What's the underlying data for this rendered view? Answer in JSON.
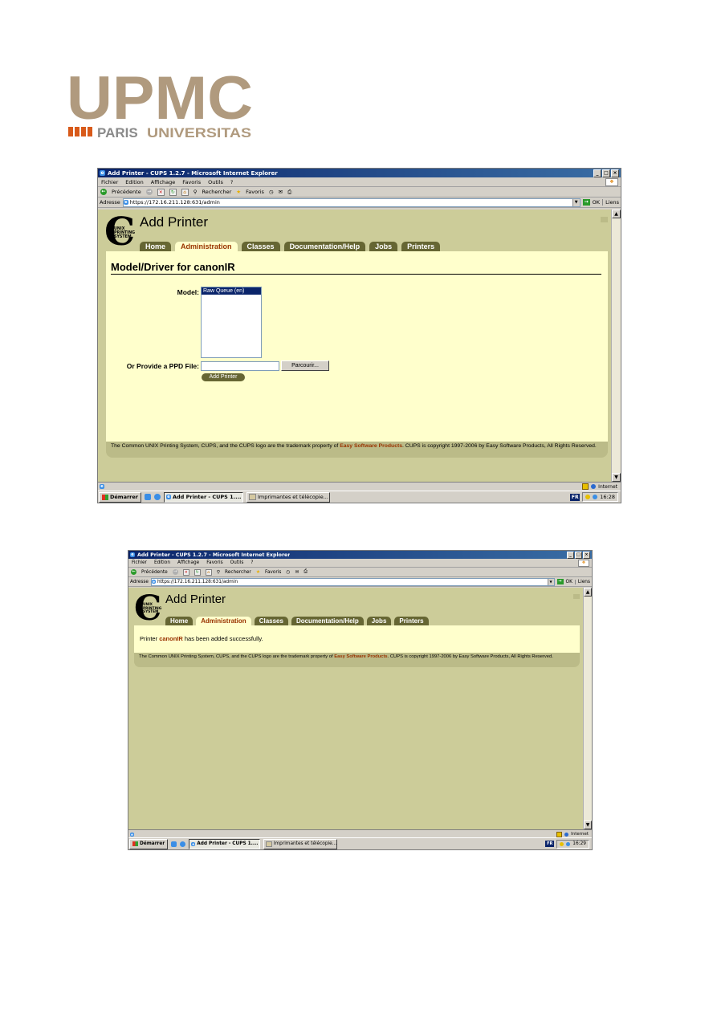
{
  "logo": {
    "main_text": "UPMC",
    "sub_left": "PARIS",
    "sub_right": "UNIVERSITAS",
    "color_main": "#b09a7e",
    "color_accent": "#d85a1a",
    "color_sub": "#8a8a8a"
  },
  "colors": {
    "page_bg": "#cccc99",
    "panel_bg": "#ffffcc",
    "tab_bg": "#666633",
    "tab_selected_text": "#993300",
    "link_text": "#993300",
    "titlebar": "#0a246a"
  },
  "screenshots": [
    {
      "window": {
        "title": "Add Printer - CUPS 1.2.7 - Microsoft Internet Explorer",
        "buttons": [
          "_",
          "□",
          "×"
        ]
      },
      "menu": [
        "Fichier",
        "Edition",
        "Affichage",
        "Favoris",
        "Outils",
        "?"
      ],
      "toolbar": {
        "back": "Précédente",
        "search": "Rechercher",
        "favorites": "Favoris"
      },
      "address": {
        "label": "Adresse",
        "url": "https://172.16.211.128:631/admin",
        "go": "OK",
        "links": "Liens"
      },
      "cups": {
        "logo_letter": "C",
        "logo_lines": [
          "UNIX",
          "PRINTING",
          "SYSTEM"
        ],
        "page_title": "Add Printer",
        "tabs": [
          "Home",
          "Administration",
          "Classes",
          "Documentation/Help",
          "Jobs",
          "Printers"
        ],
        "selected_tab": "Administration"
      },
      "form": {
        "heading": "Model/Driver for canonIR",
        "model_label": "Model:",
        "model_option": "Raw Queue (en)",
        "ppd_label": "Or Provide a PPD File:",
        "browse_button": "Parcourir...",
        "submit_button": "Add Printer"
      },
      "footer": {
        "text_before": "The Common UNIX Printing System, CUPS, and the CUPS logo are the trademark property of ",
        "company": "Easy Software Products",
        "text_after": ". CUPS is copyright 1997-2006 by Easy Software Products, All Rights Reserved."
      },
      "status": {
        "zone": "Internet"
      },
      "taskbar": {
        "start": "Démarrer",
        "task1": "Add Printer - CUPS 1....",
        "task2": "Imprimantes et télécopie...",
        "lang": "FR",
        "time": "16:28"
      }
    },
    {
      "window": {
        "title": "Add Printer - CUPS 1.2.7 - Microsoft Internet Explorer",
        "buttons": [
          "_",
          "□",
          "×"
        ]
      },
      "menu": [
        "Fichier",
        "Edition",
        "Affichage",
        "Favoris",
        "Outils",
        "?"
      ],
      "toolbar": {
        "back": "Précédente",
        "search": "Rechercher",
        "favorites": "Favoris"
      },
      "address": {
        "label": "Adresse",
        "url": "https://172.16.211.128:631/admin",
        "go": "OK",
        "links": "Liens"
      },
      "cups": {
        "logo_letter": "C",
        "logo_lines": [
          "UNIX",
          "PRINTING",
          "SYSTEM"
        ],
        "page_title": "Add Printer",
        "tabs": [
          "Home",
          "Administration",
          "Classes",
          "Documentation/Help",
          "Jobs",
          "Printers"
        ],
        "selected_tab": "Administration"
      },
      "message": {
        "before": "Printer ",
        "printer": "canonIR",
        "after": " has been added successfully."
      },
      "footer": {
        "text_before": "The Common UNIX Printing System, CUPS, and the CUPS logo are the trademark property of ",
        "company": "Easy Software Products",
        "text_after": ". CUPS is copyright 1997-2006 by Easy Software Products, All Rights Reserved."
      },
      "status": {
        "zone": "Internet"
      },
      "taskbar": {
        "start": "Démarrer",
        "task1": "Add Printer - CUPS 1....",
        "task2": "Imprimantes et télécopie...",
        "lang": "FR",
        "time": "16:29"
      }
    }
  ]
}
